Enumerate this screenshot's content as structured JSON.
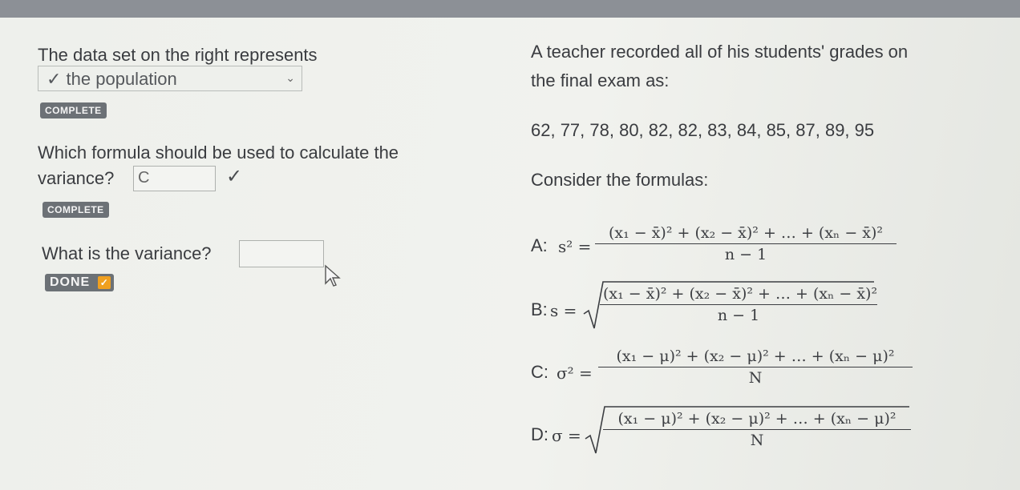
{
  "left": {
    "q1_prompt": "The data set on the right represents",
    "q1_answer": "✓ the population",
    "q1_status": "COMPLETE",
    "q2_prompt_line1": "Which formula should be used to calculate the",
    "q2_prompt_line2": "variance?",
    "q2_answer": "C",
    "q2_status": "COMPLETE",
    "q3_prompt": "What is the variance?",
    "q3_answer": "",
    "q3_status": "DONE"
  },
  "right": {
    "intro_line1": "A teacher recorded all of his students' grades on",
    "intro_line2": "the final exam as:",
    "data": "62, 77, 78, 80, 82, 82, 83, 84, 85, 87, 89, 95",
    "consider": "Consider the formulas:",
    "formulas": [
      {
        "label": "A:",
        "lhs": "s² =",
        "numerator": "(x₁ − x̄)² + (x₂ − x̄)² + … + (xₙ − x̄)²",
        "denominator": "n − 1"
      },
      {
        "label": "B:",
        "lhs": "s =",
        "numerator": "(x₁ − x̄)² + (x₂ − x̄)² + … + (xₙ − x̄)²",
        "denominator": "n − 1"
      },
      {
        "label": "C:",
        "lhs": "σ² =",
        "numerator": "(x₁ − μ)² + (x₂ − μ)² + … + (xₙ − μ)²",
        "denominator": "N"
      },
      {
        "label": "D:",
        "lhs": "σ =",
        "numerator": "(x₁ − μ)² + (x₂ − μ)² + … + (xₙ − μ)²",
        "denominator": "N"
      }
    ]
  },
  "icons": {
    "dropdown": "chevron-down-icon",
    "correct": "checkmark-icon",
    "pointer": "mouse-cursor-icon",
    "done": "checkbox-checked-icon"
  }
}
